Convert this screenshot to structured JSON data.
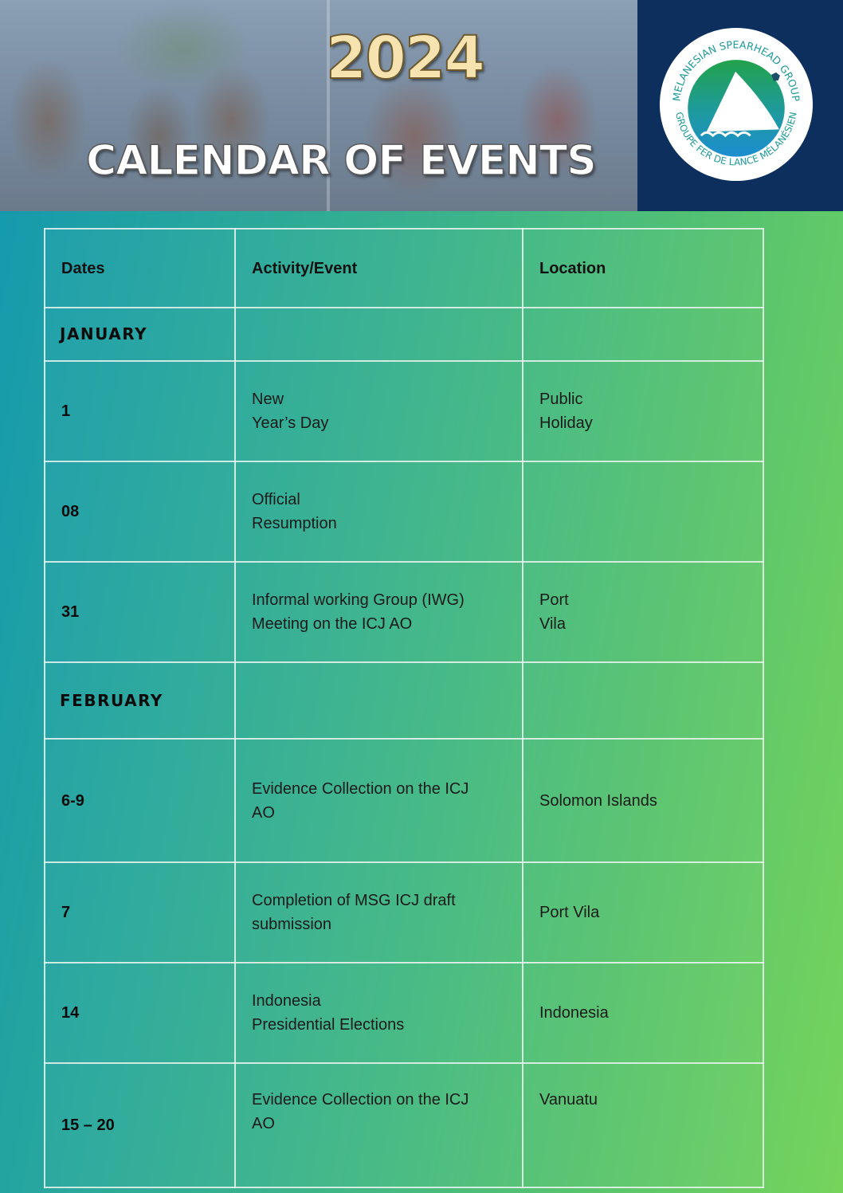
{
  "header": {
    "year": "2024",
    "title": "CALENDAR OF EVENTS",
    "logo": {
      "icon": "msg-logo-icon",
      "text_top": "MELANESIAN SPEARHEAD GROUP",
      "text_bottom": "GROUPE FER DE LANCE MÉLANÉSIEN"
    }
  },
  "table": {
    "columns": [
      "Dates",
      "Activity/Event",
      "Location"
    ],
    "months": [
      {
        "name": "JANUARY",
        "rows": [
          {
            "date": "1",
            "event": "New\nYear’s Day",
            "location": "Public\nHoliday"
          },
          {
            "date": "08",
            "event": "Official\nResumption",
            "location": ""
          },
          {
            "date": "31",
            "event": "Informal working Group (IWG)\nMeeting on the ICJ AO",
            "location": "Port\nVila"
          }
        ]
      },
      {
        "name": "FEBRUARY",
        "rows": [
          {
            "date": "6-9",
            "event": "Evidence Collection on the ICJ\nAO",
            "location": "Solomon Islands"
          },
          {
            "date": "7",
            "event": "Completion of MSG ICJ draft\nsubmission",
            "location": "Port Vila"
          },
          {
            "date": "14",
            "event": "Indonesia\nPresidential Elections",
            "location": "Indonesia"
          },
          {
            "date": "15 – 20",
            "event": "Evidence Collection on the ICJ\nAO",
            "location": "Vanuatu"
          }
        ]
      }
    ]
  },
  "colors": {
    "header_bg": "#0c2f5e",
    "gradient_start": "#1398b0",
    "gradient_end": "#76d45c",
    "year_color": "#f7e3b0",
    "grid_line": "#ebf5f0"
  }
}
